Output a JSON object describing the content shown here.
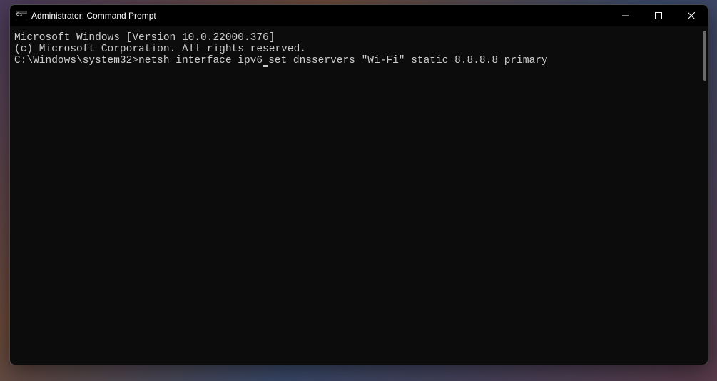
{
  "window": {
    "title": "Administrator: Command Prompt"
  },
  "terminal": {
    "line1": "Microsoft Windows [Version 10.0.22000.376]",
    "line2": "(c) Microsoft Corporation. All rights reserved.",
    "blank": "",
    "prompt": "C:\\Windows\\system32>",
    "command_before_cursor": "netsh interface ipv6",
    "command_after_cursor": "set dnsservers \"Wi-Fi\" static 8.8.8.8 primary"
  }
}
